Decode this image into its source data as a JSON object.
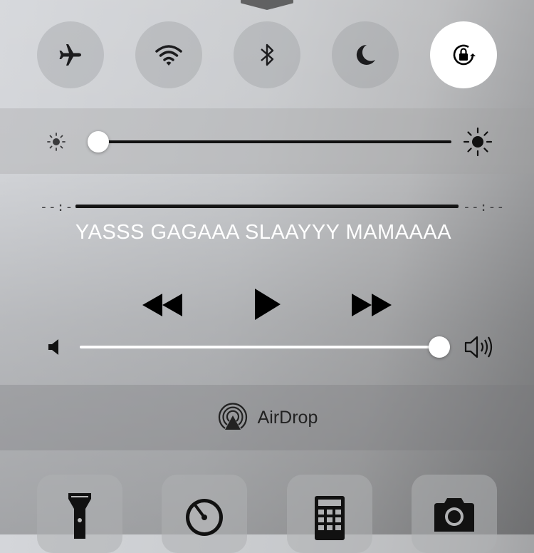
{
  "toggles": [
    {
      "name": "airplane-mode-toggle",
      "icon": "airplane-icon",
      "active": false
    },
    {
      "name": "wifi-toggle",
      "icon": "wifi-icon",
      "active": false
    },
    {
      "name": "bluetooth-toggle",
      "icon": "bluetooth-icon",
      "active": false
    },
    {
      "name": "do-not-disturb-toggle",
      "icon": "moon-icon",
      "active": false
    },
    {
      "name": "rotation-lock-toggle",
      "icon": "rotation-lock-icon",
      "active": true
    }
  ],
  "brightness": {
    "level": 0.02,
    "min_icon": "sun-small-icon",
    "max_icon": "sun-large-icon"
  },
  "now_playing": {
    "elapsed": "--:--",
    "remaining": "--:--",
    "title": "YASSS GAGAAA SLAAYYY MAMAAAA",
    "controls": [
      "rewind-icon",
      "play-icon",
      "fast-forward-icon"
    ]
  },
  "volume": {
    "level": 0.99,
    "min_icon": "speaker-low-icon",
    "max_icon": "speaker-high-icon"
  },
  "airdrop": {
    "label": "AirDrop",
    "icon": "airdrop-icon"
  },
  "shortcuts": [
    "flashlight-icon",
    "timer-icon",
    "calculator-icon",
    "camera-icon"
  ],
  "colors": {
    "active_toggle": "#ffffff",
    "icon": "#1c1c1e",
    "song_title": "#ffffff"
  }
}
